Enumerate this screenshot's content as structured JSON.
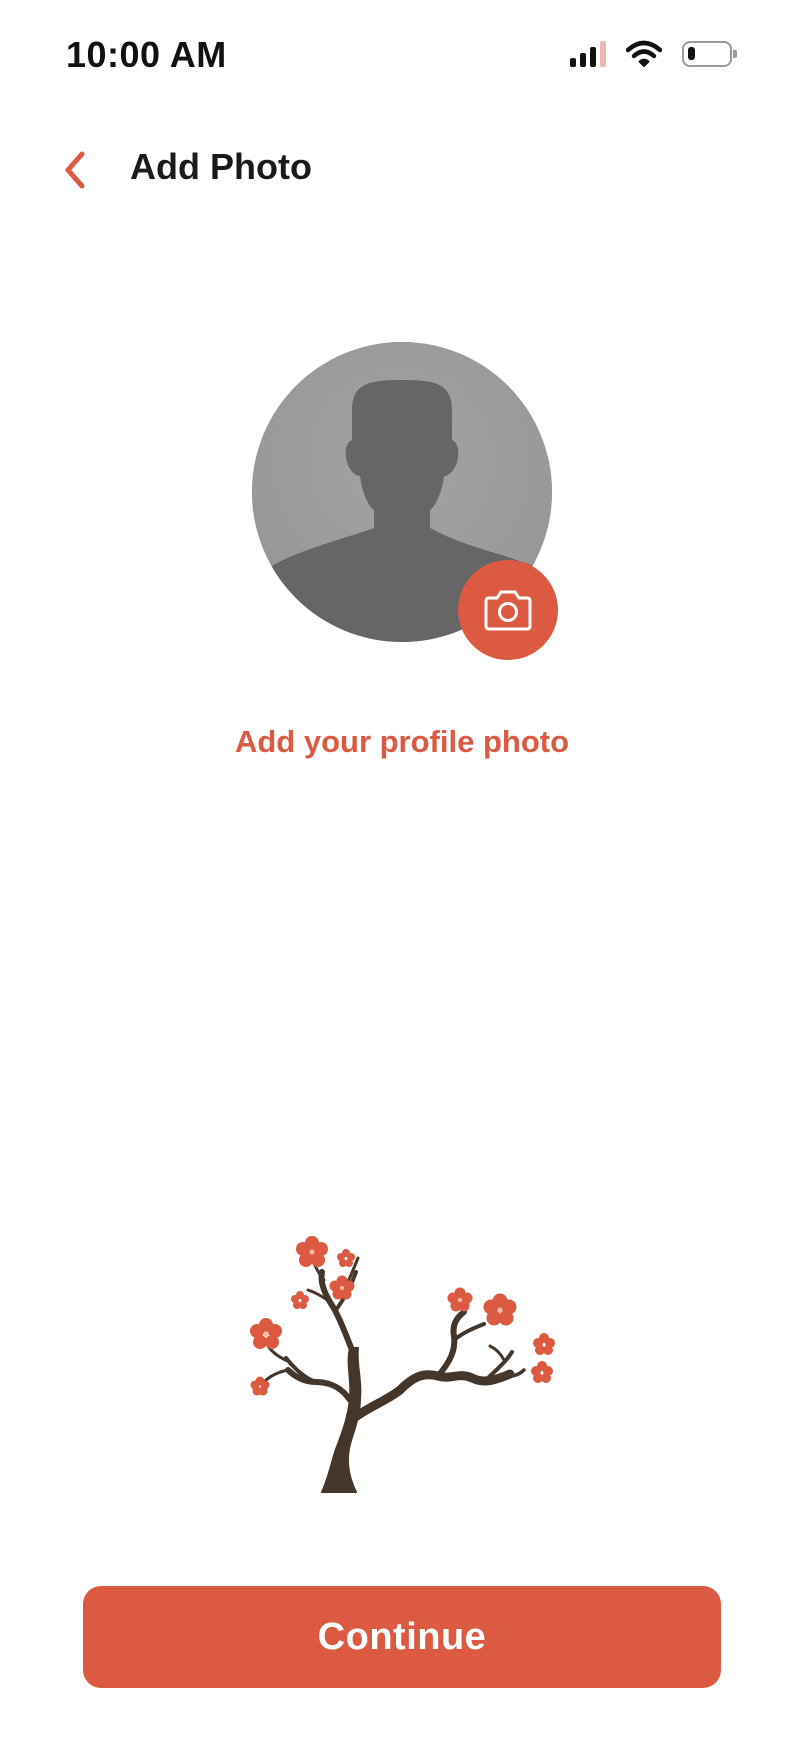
{
  "status_bar": {
    "time": "10:00 AM",
    "icons": [
      "signal-icon",
      "wifi-icon",
      "battery-icon"
    ]
  },
  "header": {
    "back_icon": "chevron-left-icon",
    "title": "Add Photo"
  },
  "avatar": {
    "placeholder_icon": "person-silhouette-icon",
    "camera_icon": "camera-icon"
  },
  "add_photo_label": "Add your profile photo",
  "illustration": "blossom-tree-icon",
  "continue_label": "Continue",
  "colors": {
    "accent": "#dc5a41",
    "avatar_bg": "#9c9c9c",
    "silhouette": "#666666",
    "trunk": "#45362b",
    "text": "#1a1a1a"
  }
}
